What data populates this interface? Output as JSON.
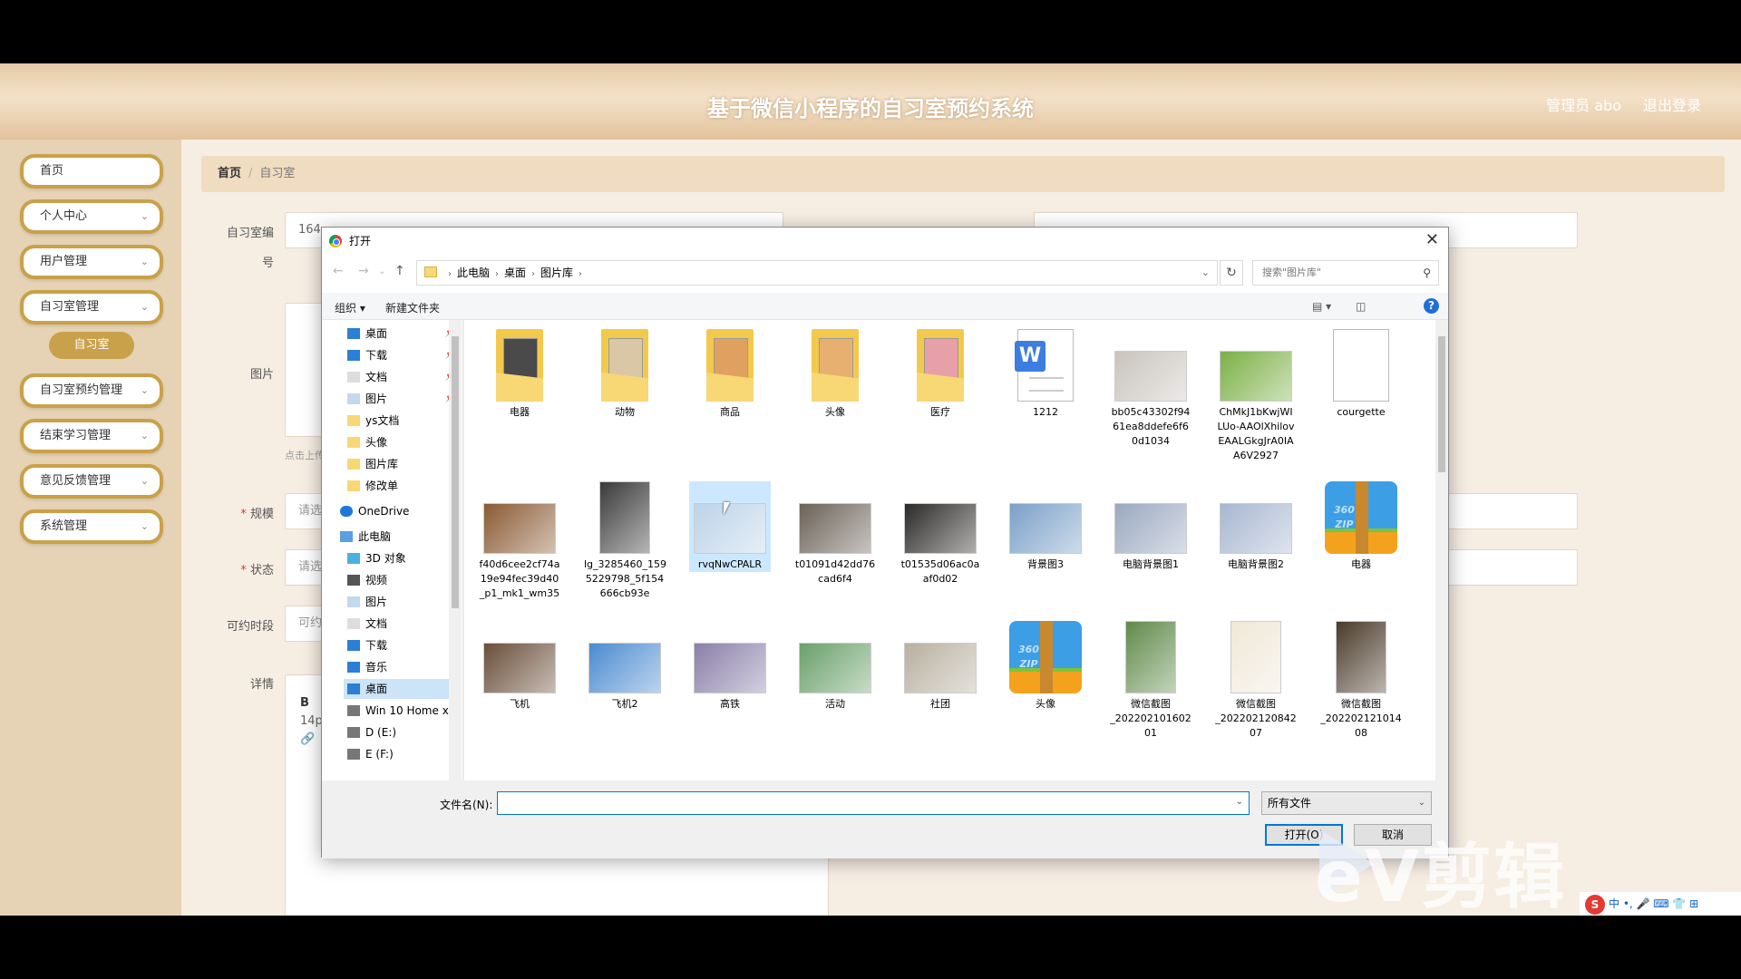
{
  "app": {
    "title": "基于微信小程序的自习室预约系统",
    "user": "管理员 abo",
    "logout": "退出登录"
  },
  "sidebar": {
    "items": [
      {
        "label": "首页"
      },
      {
        "label": "个人中心"
      },
      {
        "label": "用户管理"
      },
      {
        "label": "自习室管理"
      },
      {
        "label": "自习室预约管理"
      },
      {
        "label": "结束学习管理"
      },
      {
        "label": "意见反馈管理"
      },
      {
        "label": "系统管理"
      }
    ],
    "active_sub": "自习室"
  },
  "breadcrumb": {
    "home": "首页",
    "current": "自习室"
  },
  "form": {
    "room_no_label": "自习室编号",
    "room_no_label_a": "自习室编",
    "room_no_label_b": "号",
    "room_no_value": "164",
    "image_label": "图片",
    "upload_hint": "点击上传",
    "scale_label": "规模",
    "scale_placeholder": "请选",
    "status_label": "状态",
    "status_placeholder": "请选",
    "time_label": "可约时段",
    "time_placeholder": "可约",
    "detail_label": "详情",
    "editor_bold": "B",
    "editor_size": "14p"
  },
  "dialog": {
    "title": "打开",
    "path": [
      "此电脑",
      "桌面",
      "图片库"
    ],
    "search_placeholder": "搜索\"图片库\"",
    "toolbar": {
      "organize": "组织 ▾",
      "new_folder": "新建文件夹"
    },
    "nav": [
      {
        "label": "桌面",
        "icon": "desktop-icon",
        "pinned": true
      },
      {
        "label": "下载",
        "icon": "download-icon",
        "pinned": true
      },
      {
        "label": "文档",
        "icon": "document-icon",
        "pinned": true
      },
      {
        "label": "图片",
        "icon": "pictures-icon",
        "pinned": true
      },
      {
        "label": "ys文档",
        "icon": "folder-icon"
      },
      {
        "label": "头像",
        "icon": "folder-icon"
      },
      {
        "label": "图片库",
        "icon": "folder-icon"
      },
      {
        "label": "修改单",
        "icon": "folder-icon"
      },
      {
        "label": "OneDrive",
        "icon": "cloud-icon"
      },
      {
        "label": "此电脑",
        "icon": "computer-icon"
      },
      {
        "label": "3D 对象",
        "icon": "cube-icon"
      },
      {
        "label": "视频",
        "icon": "video-icon"
      },
      {
        "label": "图片",
        "icon": "pictures-icon"
      },
      {
        "label": "文档",
        "icon": "document-icon"
      },
      {
        "label": "下载",
        "icon": "download-icon"
      },
      {
        "label": "音乐",
        "icon": "music-icon"
      },
      {
        "label": "桌面",
        "icon": "desktop-icon",
        "selected": true
      },
      {
        "label": "Win 10 Home x",
        "icon": "drive-icon"
      },
      {
        "label": "D (E:)",
        "icon": "drive-icon"
      },
      {
        "label": "E (F:)",
        "icon": "drive-icon"
      }
    ],
    "files": [
      {
        "name": "电器",
        "kind": "folder",
        "color": "#4a4a4a"
      },
      {
        "name": "动物",
        "kind": "folder",
        "color": "#d9c7a5"
      },
      {
        "name": "商品",
        "kind": "folder",
        "color": "#e0a060"
      },
      {
        "name": "头像",
        "kind": "folder",
        "color": "#e8b070"
      },
      {
        "name": "医疗",
        "kind": "folder",
        "color": "#e8a0a8"
      },
      {
        "name": "1212",
        "kind": "word"
      },
      {
        "name": "bb05c43302f94\n61ea8ddefe6f6\n0d1034",
        "kind": "image",
        "color": "#c9c4bd"
      },
      {
        "name": "ChMkJ1bKwjWI\nLUo-AAOlXhilov\nEAALGkgJrA0IA\nA6V2927",
        "kind": "image",
        "color": "#7bb046"
      },
      {
        "name": "courgette",
        "kind": "blank"
      },
      {
        "name": "f40d6cee2cf74a\n19e94fec39d40\n_p1_mk1_wm35",
        "kind": "image",
        "color": "#8a5a33"
      },
      {
        "name": "lg_3285460_159\n5229798_5f154\n666cb93e",
        "kind": "image",
        "color": "#3a3a3a"
      },
      {
        "name": "rvqNwCPALR",
        "kind": "image",
        "color": "#bcd3e8",
        "selected": true
      },
      {
        "name": "t01091d42dd76\ncad6f4",
        "kind": "image",
        "color": "#6b6258"
      },
      {
        "name": "t01535d06ac0a\naf0d02",
        "kind": "image",
        "color": "#2c2a28"
      },
      {
        "name": "背景图3",
        "kind": "image",
        "color": "#7aa0c8"
      },
      {
        "name": "电脑背景图1",
        "kind": "image",
        "color": "#9aa8c0"
      },
      {
        "name": "电脑背景图2",
        "kind": "image",
        "color": "#a7b6d0"
      },
      {
        "name": "电器",
        "kind": "zip"
      },
      {
        "name": "飞机",
        "kind": "image",
        "color": "#6a4e3a"
      },
      {
        "name": "飞机2",
        "kind": "image",
        "color": "#4b8bd0"
      },
      {
        "name": "高铁",
        "kind": "image",
        "color": "#8a7fa8"
      },
      {
        "name": "活动",
        "kind": "image",
        "color": "#6aa06a"
      },
      {
        "name": "社团",
        "kind": "image",
        "color": "#b8b0a0"
      },
      {
        "name": "头像",
        "kind": "zip"
      },
      {
        "name": "微信截图\n_202202101602\n01",
        "kind": "image",
        "color": "#5f8a4a"
      },
      {
        "name": "微信截图\n_202202120842\n07",
        "kind": "image",
        "color": "#f0e8d8"
      },
      {
        "name": "微信截图\n_202202121014\n08",
        "kind": "image",
        "color": "#4a3a2a"
      }
    ],
    "filename_label": "文件名(N):",
    "filename_value": "",
    "filetype": "所有文件",
    "open_label": "打开(O)",
    "cancel_label": "取消"
  },
  "overlay": {
    "watermark": "eV剪辑",
    "ime": "中 •, 🎤 ⌨ 👕 ⊞"
  }
}
